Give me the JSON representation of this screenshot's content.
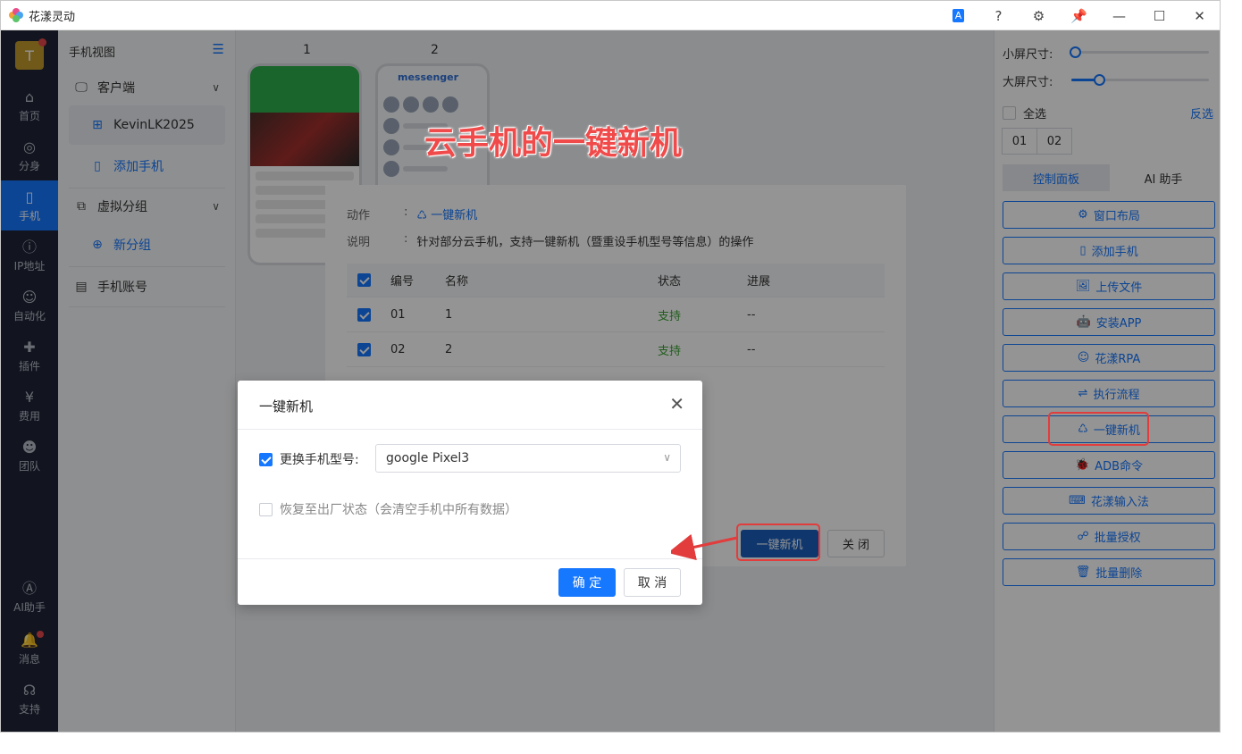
{
  "app": {
    "title": "花漾灵动"
  },
  "window_controls": [
    "A",
    "?",
    "⚙",
    "📌",
    "—",
    "☐",
    "✕"
  ],
  "leftnav": {
    "avatar": "T",
    "items": [
      {
        "label": "首页",
        "icon": "home-icon",
        "glyph": "⌂"
      },
      {
        "label": "分身",
        "icon": "chrome-icon",
        "glyph": "◎"
      },
      {
        "label": "手机",
        "icon": "phone-icon",
        "glyph": "▯"
      },
      {
        "label": "IP地址",
        "icon": "ip-icon",
        "glyph": "ⓘ"
      },
      {
        "label": "自动化",
        "icon": "robot-icon",
        "glyph": "☺"
      },
      {
        "label": "插件",
        "icon": "puzzle-icon",
        "glyph": "✚"
      },
      {
        "label": "费用",
        "icon": "yen-icon",
        "glyph": "¥"
      },
      {
        "label": "团队",
        "icon": "team-icon",
        "glyph": "☻"
      }
    ],
    "bottom": [
      {
        "label": "AI助手",
        "icon": "ai-icon",
        "glyph": "Ⓐ"
      },
      {
        "label": "消息",
        "icon": "bell-icon",
        "glyph": "🔔"
      },
      {
        "label": "支持",
        "icon": "headset-icon",
        "glyph": "☊"
      }
    ]
  },
  "sidepanel": {
    "title": "手机视图",
    "client": "客户端",
    "device": "KevinLK2025",
    "add_phone": "添加手机",
    "virtual_group": "虚拟分组",
    "new_group": "新分组",
    "account": "手机账号"
  },
  "main": {
    "columns": [
      "1",
      "2"
    ],
    "phone2_app": "messenger"
  },
  "rightpanel": {
    "small_size": "小屏尺寸:",
    "large_size": "大屏尺寸:",
    "small_level": 0.0,
    "large_level": 0.2,
    "select_all": "全选",
    "invert": "反选",
    "numbers": [
      "01",
      "02"
    ],
    "tabs": [
      "控制面板",
      "AI 助手"
    ],
    "buttons": [
      {
        "label": "窗口布局",
        "glyph": "⚙"
      },
      {
        "label": "添加手机",
        "glyph": "▯"
      },
      {
        "label": "上传文件",
        "glyph": "🖼"
      },
      {
        "label": "安装APP",
        "glyph": "🤖"
      },
      {
        "label": "花漾RPA",
        "glyph": "☺"
      },
      {
        "label": "执行流程",
        "glyph": "⇌"
      },
      {
        "label": "一键新机",
        "glyph": "♺"
      },
      {
        "label": "ADB命令",
        "glyph": "🐞"
      },
      {
        "label": "花漾输入法",
        "glyph": "⌨"
      },
      {
        "label": "批量授权",
        "glyph": "☍"
      },
      {
        "label": "批量删除",
        "glyph": "🗑"
      }
    ]
  },
  "action": {
    "action_label": "动作",
    "action_value": "一键新机",
    "desc_label": "说明",
    "desc_value": "针对部分云手机，支持一键新机（暨重设手机型号等信息）的操作",
    "colon": ":",
    "headers": [
      "编号",
      "名称",
      "状态",
      "进展"
    ],
    "rows": [
      {
        "id": "01",
        "name": "1",
        "status": "支持",
        "progress": "--"
      },
      {
        "id": "02",
        "name": "2",
        "status": "支持",
        "progress": "--"
      }
    ],
    "confirm": "一键新机",
    "close": "关 闭"
  },
  "modal": {
    "title": "一键新机",
    "change_model_label": "更换手机型号:",
    "model_value": "google Pixel3",
    "factory_reset_label": "恢复至出厂状态",
    "factory_reset_hint": "（会清空手机中所有数据）",
    "ok": "确 定",
    "cancel": "取 消"
  },
  "annotation": {
    "text": "云手机的一键新机"
  },
  "colors": {
    "accent": "#1677ff",
    "nav_bg": "#1f2536",
    "highlight": "#e23c3c",
    "support_green": "#3aa132"
  }
}
